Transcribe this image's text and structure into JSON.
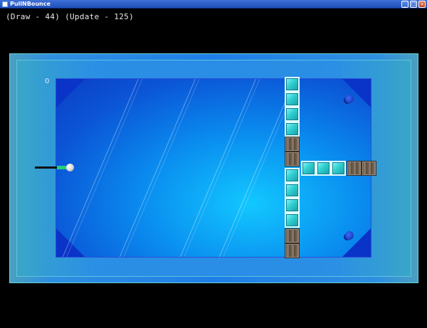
{
  "window": {
    "title": "PullNBounce",
    "min_glyph": "_",
    "max_glyph": "□",
    "close_glyph": "×"
  },
  "debug": {
    "text": "(Draw - 44) (Update - 125)"
  },
  "game": {
    "score": "0",
    "colors": {
      "field": "#0a8ff0",
      "frame": "#2f8fe0",
      "glass_block": "#2fd0d0",
      "wood_block": "#6a5a4a",
      "power_bar": "#22d27a"
    },
    "block_types": [
      "glass",
      "wood"
    ],
    "targets": 2
  }
}
